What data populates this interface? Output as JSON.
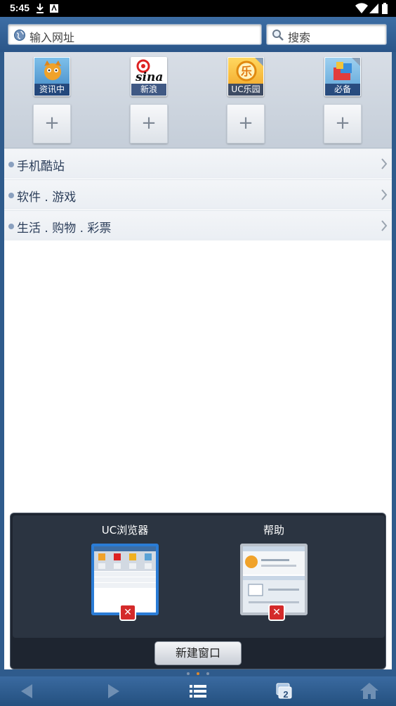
{
  "status_bar": {
    "time": "5:45"
  },
  "toolbar": {
    "url_placeholder": "输入网址",
    "search_placeholder": "搜索"
  },
  "quick_access": {
    "tiles": [
      {
        "label": "资讯中"
      },
      {
        "label": "新浪",
        "logo_text": "sina"
      },
      {
        "label": "UC乐园"
      },
      {
        "label": "必备"
      }
    ],
    "add_label": "+"
  },
  "nav_list": [
    {
      "label": "手机酷站"
    },
    {
      "label": "软件 . 游戏"
    },
    {
      "label": "生活 . 购物 . 彩票"
    }
  ],
  "window_switcher": {
    "windows": [
      {
        "title": "UC浏览器",
        "active": true
      },
      {
        "title": "帮助",
        "active": false
      }
    ],
    "new_window_label": "新建窗口",
    "close_label": "✕"
  },
  "bottom_bar": {
    "window_count": "2"
  },
  "colors": {
    "accent": "#2a7cd6",
    "toolbar": "#2f5b8c",
    "close": "#d42a2a",
    "page_dot_active": "#e08a2c"
  }
}
